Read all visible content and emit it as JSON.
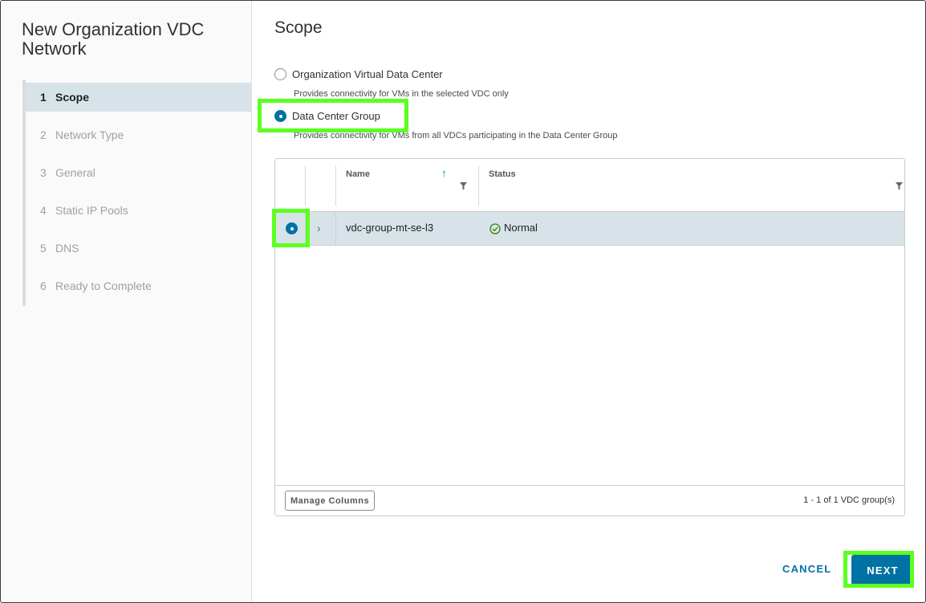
{
  "wizard": {
    "title": "New Organization VDC Network",
    "steps": [
      {
        "num": "1",
        "label": "Scope",
        "active": true
      },
      {
        "num": "2",
        "label": "Network Type",
        "active": false
      },
      {
        "num": "3",
        "label": "General",
        "active": false
      },
      {
        "num": "4",
        "label": "Static IP Pools",
        "active": false
      },
      {
        "num": "5",
        "label": "DNS",
        "active": false
      },
      {
        "num": "6",
        "label": "Ready to Complete",
        "active": false
      }
    ]
  },
  "main": {
    "title": "Scope",
    "options": [
      {
        "label": "Organization Virtual Data Center",
        "description": "Provides connectivity for VMs in the selected VDC only",
        "selected": false
      },
      {
        "label": "Data Center Group",
        "description": "Provides connectivity for VMs from all VDCs participating in the Data Center Group",
        "selected": true
      }
    ]
  },
  "grid": {
    "columns": [
      {
        "label": "Name",
        "sort": "ascending"
      },
      {
        "label": "Status"
      }
    ],
    "rows": [
      {
        "name": "vdc-group-mt-se-l3",
        "status": "Normal",
        "selected": true
      }
    ],
    "footer": {
      "manage_columns": "Manage Columns",
      "count": "1 - 1 of 1 VDC group(s)"
    }
  },
  "buttons": {
    "cancel": "CANCEL",
    "next": "NEXT"
  },
  "colors": {
    "accent": "#0072a3",
    "selected_row": "#d8e3e9",
    "highlight": "#5cff1f",
    "status_ok": "#2f8400"
  },
  "icons": [
    "radio-icon",
    "sort-ascending-icon",
    "filter-icon",
    "chevron-right-icon",
    "check-circle-icon"
  ]
}
